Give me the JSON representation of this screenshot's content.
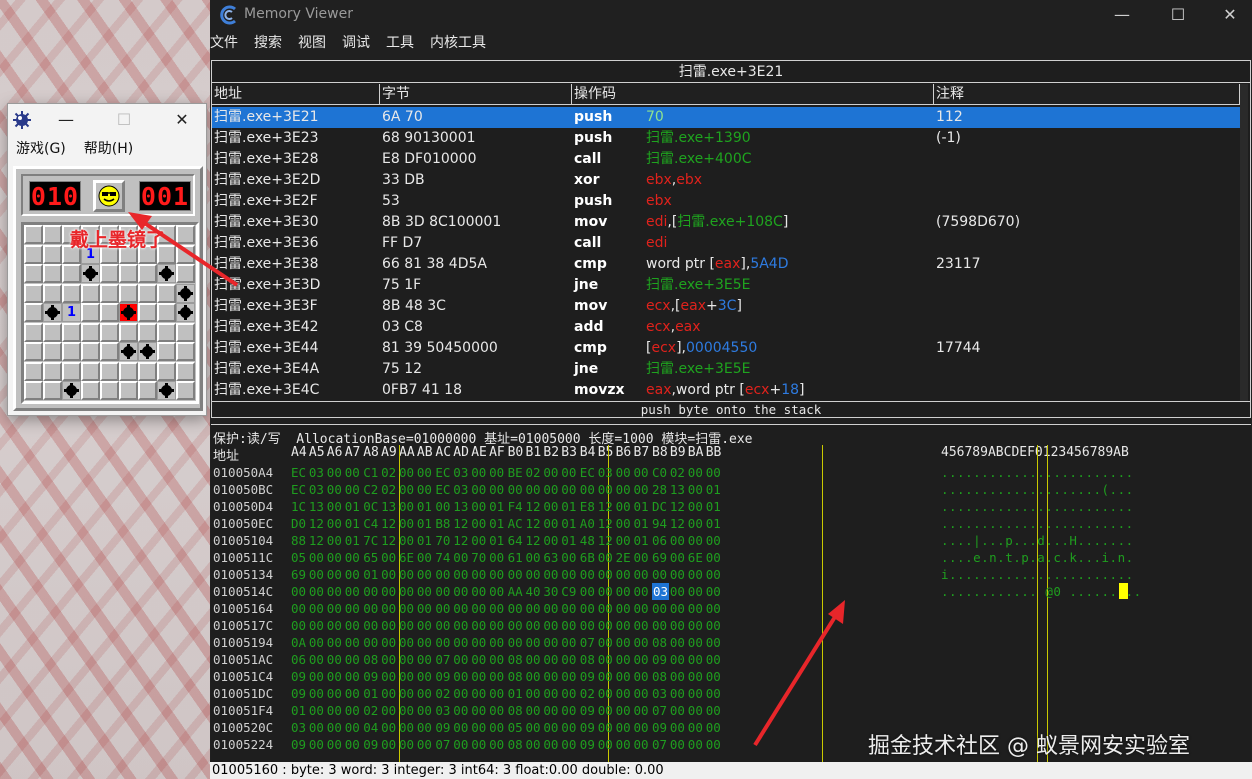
{
  "minesweeper": {
    "menu": [
      "游戏(G)",
      "帮助(H)"
    ],
    "mines_left": "010",
    "timer": "001",
    "annotation": "戴上墨镜了",
    "numbers": [
      {
        "row": 1,
        "col": 3,
        "value": "1"
      },
      {
        "row": 4,
        "col": 2,
        "value": "1"
      }
    ]
  },
  "memory_viewer": {
    "title": "Memory Viewer",
    "menu": [
      "文件",
      "搜索",
      "视图",
      "调试",
      "工具",
      "内核工具"
    ],
    "disasm_address": "扫雷.exe+3E21",
    "columns": [
      "地址",
      "字节",
      "操作码",
      "注释"
    ],
    "rows": [
      {
        "addr": "扫雷.exe+3E21",
        "bytes": "6A 70",
        "op": "push",
        "args": [
          [
            "70",
            "g"
          ]
        ],
        "comment": "112",
        "selected": true
      },
      {
        "addr": "扫雷.exe+3E23",
        "bytes": "68 90130001",
        "op": "push",
        "args": [
          [
            "扫雷.exe+1390",
            "g"
          ]
        ],
        "comment": "(-1)"
      },
      {
        "addr": "扫雷.exe+3E28",
        "bytes": "E8 DF010000",
        "op": "call",
        "args": [
          [
            "扫雷.exe+400C",
            "g"
          ]
        ],
        "comment": ""
      },
      {
        "addr": "扫雷.exe+3E2D",
        "bytes": "33 DB",
        "op": "xor",
        "args": [
          [
            "ebx",
            "r"
          ],
          [
            ",",
            "w"
          ],
          [
            "ebx",
            "r"
          ]
        ],
        "comment": ""
      },
      {
        "addr": "扫雷.exe+3E2F",
        "bytes": "53",
        "op": "push",
        "args": [
          [
            "ebx",
            "r"
          ]
        ],
        "comment": ""
      },
      {
        "addr": "扫雷.exe+3E30",
        "bytes": "8B 3D 8C100001",
        "op": "mov",
        "args": [
          [
            "edi",
            "r"
          ],
          [
            ",[",
            "w"
          ],
          [
            "扫雷.exe+108C",
            "g"
          ],
          [
            "]",
            "w"
          ]
        ],
        "comment": "(7598D670)"
      },
      {
        "addr": "扫雷.exe+3E36",
        "bytes": "FF D7",
        "op": "call",
        "args": [
          [
            "edi",
            "r"
          ]
        ],
        "comment": ""
      },
      {
        "addr": "扫雷.exe+3E38",
        "bytes": "66 81 38 4D5A",
        "op": "cmp",
        "args": [
          [
            "word ptr [",
            "w"
          ],
          [
            "eax",
            "r"
          ],
          [
            "],",
            "w"
          ],
          [
            "5A4D",
            "b"
          ]
        ],
        "comment": "23117"
      },
      {
        "addr": "扫雷.exe+3E3D",
        "bytes": "75 1F",
        "op": "jne",
        "args": [
          [
            "扫雷.exe+3E5E",
            "g"
          ]
        ],
        "comment": ""
      },
      {
        "addr": "扫雷.exe+3E3F",
        "bytes": "8B 48 3C",
        "op": "mov",
        "args": [
          [
            "ecx",
            "r"
          ],
          [
            ",[",
            "w"
          ],
          [
            "eax",
            "r"
          ],
          [
            "+",
            "w"
          ],
          [
            "3C",
            "b"
          ],
          [
            "]",
            "w"
          ]
        ],
        "comment": ""
      },
      {
        "addr": "扫雷.exe+3E42",
        "bytes": "03 C8",
        "op": "add",
        "args": [
          [
            "ecx",
            "r"
          ],
          [
            ",",
            "w"
          ],
          [
            "eax",
            "r"
          ]
        ],
        "comment": ""
      },
      {
        "addr": "扫雷.exe+3E44",
        "bytes": "81 39 50450000",
        "op": "cmp",
        "args": [
          [
            "[",
            "w"
          ],
          [
            "ecx",
            "r"
          ],
          [
            "],",
            "w"
          ],
          [
            "00004550",
            "b"
          ]
        ],
        "comment": "17744"
      },
      {
        "addr": "扫雷.exe+3E4A",
        "bytes": "75 12",
        "op": "jne",
        "args": [
          [
            "扫雷.exe+3E5E",
            "g"
          ]
        ],
        "comment": ""
      },
      {
        "addr": "扫雷.exe+3E4C",
        "bytes": "0FB7 41 18",
        "op": "movzx",
        "args": [
          [
            "eax",
            "r"
          ],
          [
            ",word ptr [",
            "w"
          ],
          [
            "ecx",
            "r"
          ],
          [
            "+",
            "w"
          ],
          [
            "18",
            "b"
          ],
          [
            "]",
            "w"
          ]
        ],
        "comment": ""
      }
    ],
    "instruction_description": "push byte onto the stack",
    "hex_info": "保护:读/写  AllocationBase=01000000 基址=01005000 长度=1000 模块=扫雷.exe",
    "hex_header": {
      "addr_label": "地址",
      "bytes": [
        "A4",
        "A5",
        "A6",
        "A7",
        "A8",
        "A9",
        "AA",
        "AB",
        "AC",
        "AD",
        "AE",
        "AF",
        "B0",
        "B1",
        "B2",
        "B3",
        "B4",
        "B5",
        "B6",
        "B7",
        "B8",
        "B9",
        "BA",
        "BB"
      ],
      "ascii": "456789ABCDEF0123456789AB"
    },
    "hex_rows": [
      {
        "addr": "010050A4",
        "bytes": [
          "EC",
          "03",
          "00",
          "00",
          "C1",
          "02",
          "00",
          "00",
          "EC",
          "03",
          "00",
          "00",
          "BE",
          "02",
          "00",
          "00",
          "EC",
          "03",
          "00",
          "00",
          "C0",
          "02",
          "00",
          "00"
        ],
        "ascii": "........................"
      },
      {
        "addr": "010050BC",
        "bytes": [
          "EC",
          "03",
          "00",
          "00",
          "C2",
          "02",
          "00",
          "00",
          "EC",
          "03",
          "00",
          "00",
          "00",
          "00",
          "00",
          "00",
          "00",
          "00",
          "00",
          "00",
          "28",
          "13",
          "00",
          "01"
        ],
        "ascii": "....................(..."
      },
      {
        "addr": "010050D4",
        "bytes": [
          "1C",
          "13",
          "00",
          "01",
          "0C",
          "13",
          "00",
          "01",
          "00",
          "13",
          "00",
          "01",
          "F4",
          "12",
          "00",
          "01",
          "E8",
          "12",
          "00",
          "01",
          "DC",
          "12",
          "00",
          "01"
        ],
        "ascii": "........................"
      },
      {
        "addr": "010050EC",
        "bytes": [
          "D0",
          "12",
          "00",
          "01",
          "C4",
          "12",
          "00",
          "01",
          "B8",
          "12",
          "00",
          "01",
          "AC",
          "12",
          "00",
          "01",
          "A0",
          "12",
          "00",
          "01",
          "94",
          "12",
          "00",
          "01"
        ],
        "ascii": "........................"
      },
      {
        "addr": "01005104",
        "bytes": [
          "88",
          "12",
          "00",
          "01",
          "7C",
          "12",
          "00",
          "01",
          "70",
          "12",
          "00",
          "01",
          "64",
          "12",
          "00",
          "01",
          "48",
          "12",
          "00",
          "01",
          "06",
          "00",
          "00",
          "00"
        ],
        "ascii": "....|...p...d...H......."
      },
      {
        "addr": "0100511C",
        "bytes": [
          "05",
          "00",
          "00",
          "00",
          "65",
          "00",
          "6E",
          "00",
          "74",
          "00",
          "70",
          "00",
          "61",
          "00",
          "63",
          "00",
          "6B",
          "00",
          "2E",
          "00",
          "69",
          "00",
          "6E",
          "00"
        ],
        "ascii": "....e.n.t.p.a.c.k...i.n."
      },
      {
        "addr": "01005134",
        "bytes": [
          "69",
          "00",
          "00",
          "00",
          "01",
          "00",
          "00",
          "00",
          "00",
          "00",
          "00",
          "00",
          "00",
          "00",
          "00",
          "00",
          "00",
          "00",
          "00",
          "00",
          "00",
          "00",
          "00",
          "00"
        ],
        "ascii": "i......................."
      },
      {
        "addr": "0100514C",
        "bytes": [
          "00",
          "00",
          "00",
          "00",
          "00",
          "00",
          "00",
          "00",
          "00",
          "00",
          "00",
          "00",
          "AA",
          "40",
          "30",
          "C9",
          "00",
          "00",
          "00",
          "00",
          "03",
          "00",
          "00",
          "00"
        ],
        "ascii": "............ @0 ........."
      },
      {
        "addr": "01005164",
        "bytes": [
          "00",
          "00",
          "00",
          "00",
          "00",
          "00",
          "00",
          "00",
          "00",
          "00",
          "00",
          "00",
          "00",
          "00",
          "00",
          "00",
          "00",
          "00",
          "00",
          "00",
          "00",
          "00",
          "00",
          "00"
        ],
        "ascii": ""
      },
      {
        "addr": "0100517C",
        "bytes": [
          "00",
          "00",
          "00",
          "00",
          "00",
          "00",
          "00",
          "00",
          "00",
          "00",
          "00",
          "00",
          "00",
          "00",
          "00",
          "00",
          "00",
          "00",
          "00",
          "00",
          "00",
          "00",
          "00",
          "00"
        ],
        "ascii": ""
      },
      {
        "addr": "01005194",
        "bytes": [
          "0A",
          "00",
          "00",
          "00",
          "00",
          "00",
          "00",
          "00",
          "00",
          "00",
          "00",
          "00",
          "00",
          "00",
          "00",
          "00",
          "07",
          "00",
          "00",
          "00",
          "08",
          "00",
          "00",
          "00"
        ],
        "ascii": ""
      },
      {
        "addr": "010051AC",
        "bytes": [
          "06",
          "00",
          "00",
          "00",
          "08",
          "00",
          "00",
          "00",
          "07",
          "00",
          "00",
          "00",
          "08",
          "00",
          "00",
          "00",
          "08",
          "00",
          "00",
          "00",
          "09",
          "00",
          "00",
          "00"
        ],
        "ascii": ""
      },
      {
        "addr": "010051C4",
        "bytes": [
          "09",
          "00",
          "00",
          "00",
          "09",
          "00",
          "00",
          "00",
          "09",
          "00",
          "00",
          "00",
          "08",
          "00",
          "00",
          "00",
          "09",
          "00",
          "00",
          "00",
          "08",
          "00",
          "00",
          "00"
        ],
        "ascii": ""
      },
      {
        "addr": "010051DC",
        "bytes": [
          "09",
          "00",
          "00",
          "00",
          "01",
          "00",
          "00",
          "00",
          "02",
          "00",
          "00",
          "00",
          "01",
          "00",
          "00",
          "00",
          "02",
          "00",
          "00",
          "00",
          "03",
          "00",
          "00",
          "00"
        ],
        "ascii": ""
      },
      {
        "addr": "010051F4",
        "bytes": [
          "01",
          "00",
          "00",
          "00",
          "02",
          "00",
          "00",
          "00",
          "03",
          "00",
          "00",
          "00",
          "08",
          "00",
          "00",
          "00",
          "09",
          "00",
          "00",
          "00",
          "07",
          "00",
          "00",
          "00"
        ],
        "ascii": ""
      },
      {
        "addr": "0100520C",
        "bytes": [
          "03",
          "00",
          "00",
          "00",
          "04",
          "00",
          "00",
          "00",
          "09",
          "00",
          "00",
          "00",
          "05",
          "00",
          "00",
          "00",
          "09",
          "00",
          "00",
          "00",
          "09",
          "00",
          "00",
          "00"
        ],
        "ascii": ""
      },
      {
        "addr": "01005224",
        "bytes": [
          "09",
          "00",
          "00",
          "00",
          "09",
          "00",
          "00",
          "00",
          "07",
          "00",
          "00",
          "00",
          "08",
          "00",
          "00",
          "00",
          "09",
          "00",
          "00",
          "00",
          "07",
          "00",
          "00",
          "00"
        ],
        "ascii": ""
      }
    ],
    "status": "01005160 : byte: 3 word: 3 integer: 3 int64: 3 float:0.00 double: 0.00"
  },
  "watermark": "掘金技术社区 @ 蚁景网安实验室",
  "colors": {
    "accent": "#1e74d4",
    "hex_green": "#1f9e1f",
    "arrow_red": "#e8262a"
  }
}
